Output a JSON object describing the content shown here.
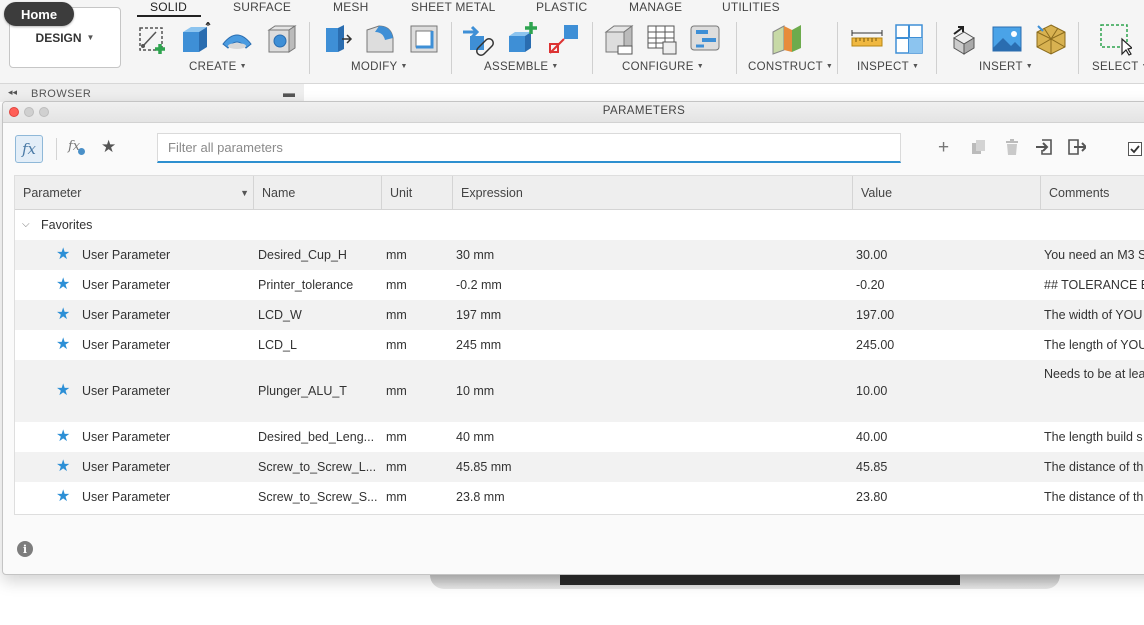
{
  "home_tooltip": "Home",
  "workspace": {
    "label": "DESIGN"
  },
  "tabs": [
    {
      "label": "SOLID",
      "active": true
    },
    {
      "label": "SURFACE"
    },
    {
      "label": "MESH"
    },
    {
      "label": "SHEET METAL"
    },
    {
      "label": "PLASTIC"
    },
    {
      "label": "MANAGE"
    },
    {
      "label": "UTILITIES"
    }
  ],
  "groups": [
    {
      "label": "CREATE",
      "icons": [
        "sketch-icon",
        "extrude-icon",
        "revolve-icon",
        "hole-icon"
      ]
    },
    {
      "label": "MODIFY",
      "icons": [
        "press-pull-icon",
        "fillet-icon",
        "shell-icon"
      ]
    },
    {
      "label": "ASSEMBLE",
      "icons": [
        "joint-icon",
        "new-component-icon",
        "joint-origin-icon"
      ]
    },
    {
      "label": "CONFIGURE",
      "icons": [
        "configure-icon",
        "table-icon",
        "theme-icon"
      ]
    },
    {
      "label": "CONSTRUCT",
      "icons": [
        "plane-icon"
      ]
    },
    {
      "label": "INSPECT",
      "icons": [
        "measure-icon",
        "section-icon"
      ]
    },
    {
      "label": "INSERT",
      "icons": [
        "insert-derive-icon",
        "insert-image-icon",
        "insert-mesh-icon"
      ]
    },
    {
      "label": "SELECT",
      "icons": [
        "select-window-icon"
      ]
    }
  ],
  "browser": {
    "label": "BROWSER"
  },
  "dialog": {
    "title": "PARAMETERS",
    "search_placeholder": "Filter all parameters",
    "columns": [
      "Parameter",
      "Name",
      "Unit",
      "Expression",
      "Value",
      "Comments"
    ],
    "group_label": "Favorites",
    "rows": [
      {
        "type": "User Parameter",
        "name": "Desired_Cup_H",
        "unit": "mm",
        "expression": "30 mm",
        "value": "30.00",
        "comment": "You need an M3 S"
      },
      {
        "type": "User Parameter",
        "name": "Printer_tolerance",
        "unit": "mm",
        "expression": "-0.2 mm",
        "value": "-0.20",
        "comment": "## TOLERANCE BE"
      },
      {
        "type": "User Parameter",
        "name": "LCD_W",
        "unit": "mm",
        "expression": "197 mm",
        "value": "197.00",
        "comment": "The width of YOU"
      },
      {
        "type": "User Parameter",
        "name": "LCD_L",
        "unit": "mm",
        "expression": "245 mm",
        "value": "245.00",
        "comment": "The length of YOU"
      },
      {
        "type": "User Parameter",
        "name": "Plunger_ALU_T",
        "unit": "mm",
        "expression": "10 mm",
        "value": "10.00",
        "comment": "Needs to be at lea"
      },
      {
        "type": "User Parameter",
        "name": "Desired_bed_Leng...",
        "unit": "mm",
        "expression": "40 mm",
        "value": "40.00",
        "comment": "The length build s"
      },
      {
        "type": "User Parameter",
        "name": "Screw_to_Screw_L...",
        "unit": "mm",
        "expression": "45.85 mm",
        "value": "45.85",
        "comment": "The distance of th"
      },
      {
        "type": "User Parameter",
        "name": "Screw_to_Screw_S...",
        "unit": "mm",
        "expression": "23.8 mm",
        "value": "23.80",
        "comment": "The distance of th"
      }
    ]
  }
}
